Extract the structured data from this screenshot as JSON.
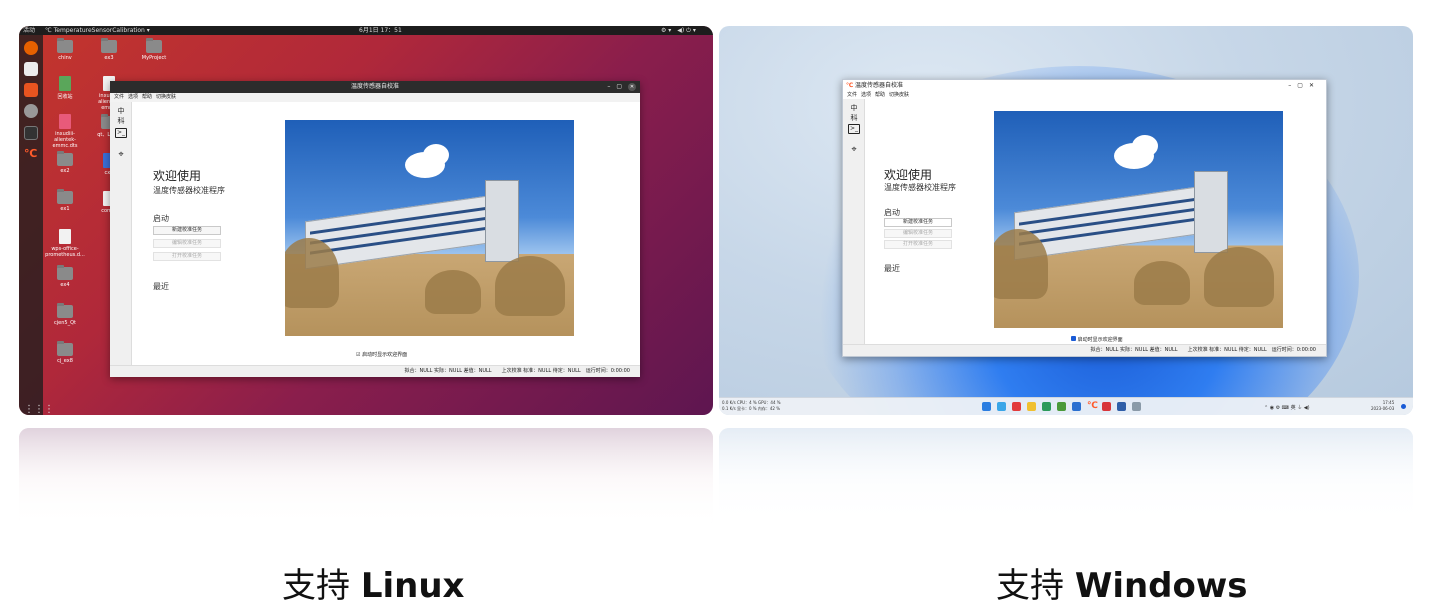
{
  "captions": {
    "linux_prefix": "支持",
    "linux_os": "Linux",
    "windows_prefix": "支持",
    "windows_os": "Windows"
  },
  "app": {
    "window_title": "温度传感器自校准",
    "menu": [
      "文件",
      "选项",
      "帮助",
      "切换皮肤"
    ],
    "welcome": "欢迎使用",
    "subtitle": "温度传感器校准程序",
    "start_section": "启动",
    "buttons": [
      "新建校准任务",
      "编辑校准任务",
      "打开校准任务"
    ],
    "recent_section": "最近",
    "show_welcome_checkbox": "启动时显示欢迎界面",
    "show_welcome_checked": true,
    "status_linux": "拟合：NULL 实际：NULL 差值：NULL　　上次校准 标准：NULL 待定：NULL　运行时间：0:00:00",
    "status_windows": "拟合：NULL 实际：NULL 差值：NULL　　上次校准 标准：NULL 待定：NULL　运行时间：0:00:00"
  },
  "ubuntu": {
    "activities": "活动",
    "app_menu": "℃ TemperatureSensorCalibration ▾",
    "clock": "6月1日 17：51",
    "desktop_icons": [
      "chinv",
      "ex3",
      "MyProject",
      "回收站",
      "inxudiiI-alientek-emmc",
      "ex2",
      "inxudiii-alientek-emmc.dts",
      "qt、Linux",
      "ex2",
      "cx1",
      "ex1",
      "comm",
      "wps-office-prometheus.d...",
      "ex4",
      "cjen5_Qt",
      "cj_ex8"
    ]
  },
  "windows": {
    "net_up": "0.0 K/s CPU：4 % GPU：44 %",
    "net_down": "0.1 K/s 显卡：0 % 内存：42 %",
    "lang": "英",
    "time": "17:45",
    "date": "2023-06-03"
  }
}
